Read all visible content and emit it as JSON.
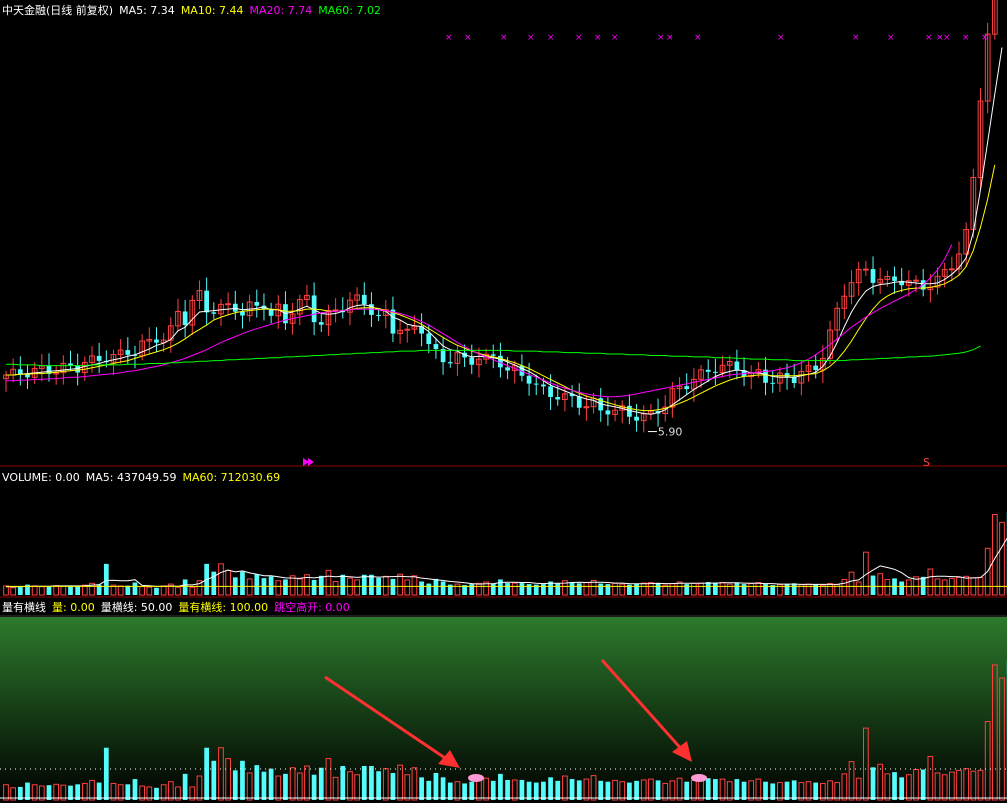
{
  "header": {
    "stock_name": "中天金融",
    "period": "(日线 前复权)",
    "ma": [
      {
        "label": "MA5: 7.34",
        "color": "#ffffff"
      },
      {
        "label": "MA10: 7.44",
        "color": "#ffff00"
      },
      {
        "label": "MA20: 7.74",
        "color": "#ff00ff"
      },
      {
        "label": "MA60: 7.02",
        "color": "#00ff00"
      }
    ]
  },
  "volume_header": [
    {
      "label": "VOLUME: 0.00",
      "color": "#ffffff"
    },
    {
      "label": "MA5: 437049.59",
      "color": "#ffffff"
    },
    {
      "label": "MA60: 712030.69",
      "color": "#ffff00"
    }
  ],
  "indicator_header": [
    {
      "label": "量有横线",
      "color": "#ffffff"
    },
    {
      "label": "量: 0.00",
      "color": "#ffff00"
    },
    {
      "label": "量横线: 50.00",
      "color": "#ffffff"
    },
    {
      "label": "量有横线: 100.00",
      "color": "#ffff00"
    },
    {
      "label": "跳空高开: 0.00",
      "color": "#ff00ff"
    }
  ],
  "colors": {
    "up": "#ff4040",
    "down": "#54fcfc",
    "ma5": "#ffffff",
    "ma10": "#ffff00",
    "ma20": "#ff00ff",
    "ma60": "#00ff00",
    "grid": "#8b0000"
  },
  "chart_data": [
    {
      "type": "candlestick",
      "panel": "price",
      "ylim": [
        5.5,
        11.6
      ],
      "low_annotation": {
        "label": "5.90",
        "index": 90
      },
      "high_marker": "S",
      "series": [
        {
          "name": "MA5",
          "values": [
            6.7,
            6.7,
            6.71,
            6.72,
            6.73,
            6.74,
            6.75,
            6.76,
            6.77,
            6.78,
            6.79,
            6.82,
            6.84,
            6.86,
            6.89,
            6.91,
            6.93,
            6.96,
            6.98,
            7.02,
            7.06,
            7.11,
            7.14,
            7.19,
            7.31,
            7.36,
            7.47,
            7.57,
            7.58,
            7.59,
            7.6,
            7.61,
            7.62,
            7.6,
            7.61,
            7.62,
            7.64,
            7.6,
            7.6,
            7.55,
            7.57,
            7.61,
            7.65,
            7.6,
            7.55,
            7.54,
            7.55,
            7.58,
            7.63,
            7.66,
            7.67,
            7.65,
            7.6,
            7.58,
            7.5,
            7.46,
            7.4,
            7.38,
            7.37,
            7.3,
            7.2,
            7.1,
            7.05,
            7.03,
            6.98,
            6.95,
            6.96,
            6.95,
            6.94,
            6.92,
            6.88,
            6.84,
            6.79,
            6.75,
            6.69,
            6.62,
            6.56,
            6.52,
            6.48,
            6.44,
            6.4,
            6.37,
            6.35,
            6.3,
            6.28,
            6.26,
            6.24,
            6.21,
            6.19,
            6.17,
            6.16,
            6.18,
            6.22,
            6.29,
            6.36,
            6.43,
            6.5,
            6.56,
            6.62,
            6.68,
            6.72,
            6.75,
            6.77,
            6.76,
            6.73,
            6.73,
            6.71,
            6.68,
            6.67,
            6.67,
            6.67,
            6.69,
            6.71,
            6.74,
            6.82,
            6.96,
            7.15,
            7.37,
            7.57,
            7.73,
            7.86,
            7.92,
            7.95,
            7.96,
            7.98,
            7.99,
            7.98,
            7.97,
            7.96,
            7.96,
            7.97,
            8.02,
            8.09,
            8.18,
            8.32,
            8.67,
            9.26,
            9.92,
            10.58,
            11.22
          ]
        },
        {
          "name": "MA10",
          "values": [
            6.7,
            6.7,
            6.71,
            6.71,
            6.72,
            6.72,
            6.73,
            6.74,
            6.75,
            6.76,
            6.77,
            6.78,
            6.8,
            6.82,
            6.84,
            6.86,
            6.88,
            6.9,
            6.93,
            6.96,
            6.99,
            7.02,
            7.05,
            7.09,
            7.14,
            7.2,
            7.27,
            7.33,
            7.39,
            7.46,
            7.5,
            7.53,
            7.56,
            7.58,
            7.59,
            7.6,
            7.61,
            7.61,
            7.6,
            7.58,
            7.58,
            7.59,
            7.61,
            7.61,
            7.6,
            7.58,
            7.58,
            7.59,
            7.6,
            7.62,
            7.63,
            7.63,
            7.62,
            7.59,
            7.56,
            7.53,
            7.49,
            7.45,
            7.4,
            7.34,
            7.28,
            7.22,
            7.16,
            7.11,
            7.07,
            7.03,
            7.0,
            6.97,
            6.95,
            6.93,
            6.9,
            6.87,
            6.83,
            6.79,
            6.74,
            6.69,
            6.64,
            6.59,
            6.54,
            6.49,
            6.45,
            6.41,
            6.38,
            6.35,
            6.32,
            6.29,
            6.26,
            6.24,
            6.22,
            6.21,
            6.21,
            6.22,
            6.24,
            6.27,
            6.31,
            6.35,
            6.4,
            6.45,
            6.5,
            6.55,
            6.59,
            6.63,
            6.66,
            6.68,
            6.69,
            6.7,
            6.7,
            6.69,
            6.69,
            6.69,
            6.69,
            6.7,
            6.71,
            6.72,
            6.76,
            6.82,
            6.91,
            7.03,
            7.17,
            7.33,
            7.48,
            7.61,
            7.72,
            7.79,
            7.84,
            7.87,
            7.89,
            7.9,
            7.9,
            7.91,
            7.93,
            7.96,
            8.01,
            8.08,
            8.2,
            8.42,
            8.74,
            9.13,
            9.6
          ]
        },
        {
          "name": "MA20",
          "values": [
            6.62,
            6.62,
            6.63,
            6.63,
            6.64,
            6.64,
            6.65,
            6.65,
            6.66,
            6.67,
            6.67,
            6.68,
            6.69,
            6.7,
            6.71,
            6.72,
            6.73,
            6.75,
            6.76,
            6.78,
            6.8,
            6.82,
            6.84,
            6.87,
            6.9,
            6.93,
            6.97,
            7.01,
            7.05,
            7.1,
            7.15,
            7.19,
            7.23,
            7.27,
            7.31,
            7.34,
            7.37,
            7.4,
            7.43,
            7.46,
            7.48,
            7.5,
            7.52,
            7.54,
            7.56,
            7.57,
            7.58,
            7.59,
            7.6,
            7.61,
            7.61,
            7.61,
            7.6,
            7.59,
            7.57,
            7.55,
            7.52,
            7.48,
            7.44,
            7.39,
            7.33,
            7.27,
            7.21,
            7.15,
            7.09,
            7.04,
            6.99,
            6.95,
            6.91,
            6.87,
            6.83,
            6.79,
            6.75,
            6.71,
            6.67,
            6.63,
            6.59,
            6.55,
            6.52,
            6.49,
            6.46,
            6.44,
            6.42,
            6.41,
            6.4,
            6.4,
            6.41,
            6.42,
            6.44,
            6.46,
            6.48,
            6.5,
            6.52,
            6.54,
            6.56,
            6.58,
            6.6,
            6.62,
            6.64,
            6.66,
            6.68,
            6.7,
            6.71,
            6.72,
            6.73,
            6.74,
            6.75,
            6.76,
            6.78,
            6.8,
            6.83,
            6.87,
            6.92,
            6.98,
            7.05,
            7.12,
            7.2,
            7.28,
            7.36,
            7.43,
            7.5,
            7.56,
            7.62,
            7.67,
            7.72,
            7.77,
            7.82,
            7.88,
            7.95,
            8.04,
            8.15,
            8.3,
            8.5
          ]
        },
        {
          "name": "MA60",
          "values": [
            6.85,
            6.85,
            6.84,
            6.84,
            6.84,
            6.83,
            6.83,
            6.83,
            6.83,
            6.83,
            6.83,
            6.83,
            6.84,
            6.84,
            6.84,
            6.84,
            6.84,
            6.85,
            6.85,
            6.85,
            6.86,
            6.86,
            6.86,
            6.87,
            6.87,
            6.88,
            6.88,
            6.89,
            6.89,
            6.9,
            6.9,
            6.91,
            6.91,
            6.92,
            6.92,
            6.93,
            6.93,
            6.94,
            6.94,
            6.95,
            6.95,
            6.96,
            6.96,
            6.97,
            6.97,
            6.98,
            6.98,
            6.99,
            6.99,
            7.0,
            7.0,
            7.01,
            7.01,
            7.02,
            7.02,
            7.03,
            7.03,
            7.03,
            7.04,
            7.04,
            7.04,
            7.04,
            7.04,
            7.04,
            7.04,
            7.04,
            7.04,
            7.04,
            7.04,
            7.04,
            7.04,
            7.03,
            7.03,
            7.03,
            7.03,
            7.02,
            7.02,
            7.02,
            7.01,
            7.01,
            7.01,
            7.0,
            7.0,
            7.0,
            6.99,
            6.99,
            6.99,
            6.98,
            6.98,
            6.98,
            6.97,
            6.97,
            6.97,
            6.96,
            6.96,
            6.96,
            6.95,
            6.95,
            6.95,
            6.94,
            6.94,
            6.94,
            6.93,
            6.93,
            6.92,
            6.92,
            6.92,
            6.91,
            6.91,
            6.91,
            6.9,
            6.9,
            6.9,
            6.9,
            6.9,
            6.9,
            6.9,
            6.9,
            6.91,
            6.91,
            6.92,
            6.92,
            6.93,
            6.93,
            6.94,
            6.94,
            6.95,
            6.95,
            6.96,
            6.96,
            6.97,
            6.98,
            6.99,
            7.0,
            7.02,
            7.05,
            7.1
          ]
        }
      ]
    },
    {
      "type": "bar",
      "panel": "volume",
      "values": [
        35,
        28,
        30,
        40,
        35,
        32,
        34,
        36,
        34,
        33,
        36,
        38,
        45,
        40,
        120,
        38,
        35,
        36,
        48,
        32,
        30,
        28,
        35,
        42,
        30,
        60,
        30,
        55,
        120,
        90,
        120,
        95,
        68,
        90,
        62,
        80,
        65,
        72,
        55,
        60,
        74,
        62,
        78,
        58,
        74,
        95,
        52,
        78,
        65,
        58,
        78,
        78,
        66,
        72,
        62,
        80,
        58,
        74,
        52,
        44,
        62,
        52,
        40,
        42,
        38,
        42,
        45,
        50,
        44,
        60,
        46,
        46,
        46,
        42,
        40,
        42,
        52,
        44,
        55,
        48,
        45,
        48,
        56,
        44,
        42,
        45,
        42,
        40,
        44,
        46,
        48,
        45,
        38,
        44,
        50,
        42,
        45,
        46,
        50,
        48,
        48,
        42,
        48,
        42,
        44,
        48,
        42,
        38,
        40,
        42,
        45,
        40,
        42,
        40,
        38,
        44,
        40,
        60,
        88,
        50,
        165,
        75,
        82,
        60,
        64,
        52,
        58,
        70,
        70,
        100,
        62,
        58,
        64,
        68,
        72,
        66,
        68,
        180,
        310,
        280,
        320,
        400,
        310,
        350,
        380,
        260
      ],
      "ma5": [
        32,
        32,
        32,
        33,
        34,
        34,
        34,
        35,
        35,
        35,
        35,
        36,
        38,
        40,
        56,
        57,
        55,
        55,
        59,
        37,
        36,
        33,
        33,
        35,
        33,
        39,
        39,
        44,
        59,
        71,
        87,
        96,
        89,
        93,
        85,
        80,
        74,
        74,
        70,
        66,
        65,
        64,
        68,
        66,
        69,
        73,
        70,
        72,
        70,
        68,
        70,
        71,
        69,
        70,
        71,
        72,
        70,
        70,
        65,
        62,
        59,
        56,
        52,
        50,
        47,
        44,
        42,
        43,
        43,
        48,
        49,
        49,
        48,
        48,
        45,
        44,
        45,
        45,
        46,
        48,
        49,
        48,
        49,
        49,
        48,
        46,
        46,
        44,
        43,
        43,
        44,
        45,
        44,
        44,
        45,
        45,
        45,
        45,
        46,
        46,
        47,
        47,
        47,
        46,
        45,
        45,
        44,
        44,
        42,
        42,
        42,
        41,
        41,
        41,
        41,
        41,
        41,
        45,
        54,
        58,
        79,
        96,
        112,
        106,
        99,
        86,
        67,
        61,
        63,
        70,
        72,
        72,
        71,
        70,
        65,
        66,
        67,
        91,
        141,
        186,
        232,
        298,
        324,
        332,
        352,
        340
      ],
      "ma60": [
        60,
        60,
        60,
        60,
        60,
        60,
        60,
        60,
        60,
        60,
        60,
        60,
        60,
        60,
        60,
        60,
        60,
        60,
        60,
        60,
        60,
        60,
        60,
        60,
        60,
        60,
        60,
        60,
        60,
        60,
        60,
        60,
        60,
        60,
        60,
        60,
        60,
        60,
        60,
        60,
        60,
        60,
        60,
        60,
        60,
        60,
        60,
        60,
        60,
        60,
        60,
        60,
        60,
        60,
        60,
        60,
        60,
        60,
        60,
        60,
        60,
        60,
        60,
        60,
        60,
        60,
        60,
        60,
        60,
        60,
        60,
        60,
        60,
        60,
        60,
        60,
        60,
        60,
        60,
        60,
        60,
        60,
        60,
        60,
        60,
        60,
        60,
        60,
        60,
        60,
        60,
        60,
        60,
        60,
        60,
        60,
        60,
        60,
        60,
        60,
        60,
        60,
        60,
        60,
        60,
        60,
        60,
        60,
        60,
        60,
        60,
        60,
        60,
        60,
        60,
        60,
        60,
        60,
        60,
        60,
        60,
        60,
        60,
        60,
        60,
        60,
        60,
        60,
        60,
        60,
        60,
        60,
        60,
        60,
        60,
        60,
        60,
        60,
        60,
        60,
        60,
        60,
        60,
        60,
        60,
        60
      ],
      "ylim": [
        0,
        420
      ]
    },
    {
      "type": "bar",
      "panel": "indicator",
      "ylim": [
        0,
        420
      ]
    }
  ]
}
